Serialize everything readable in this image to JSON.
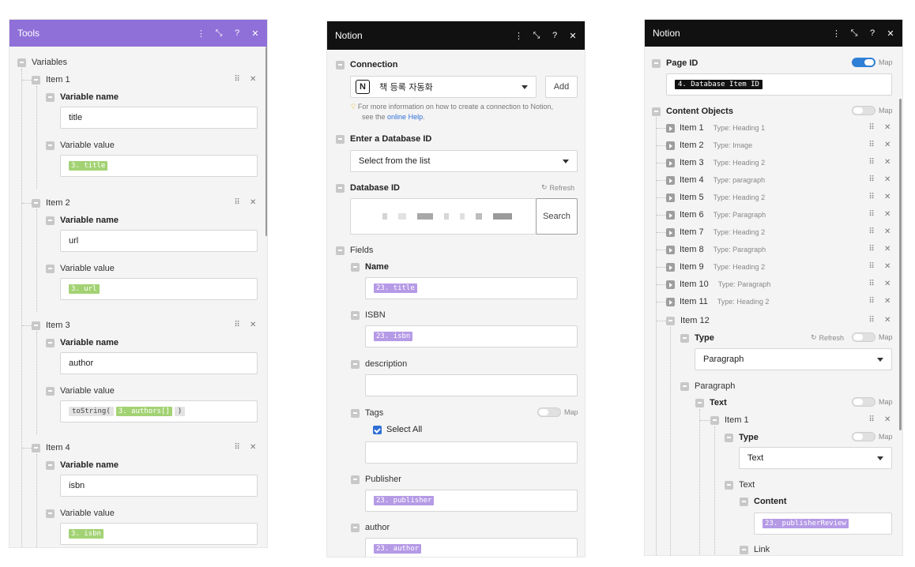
{
  "tools": {
    "title": "Tools",
    "variables_label": "Variables",
    "items": [
      {
        "label": "Item 1",
        "var_name_label": "Variable name",
        "var_name": "title",
        "var_value_label": "Variable value",
        "value_pill": "3. title"
      },
      {
        "label": "Item 2",
        "var_name_label": "Variable name",
        "var_name": "url",
        "var_value_label": "Variable value",
        "value_pill": "3. url"
      },
      {
        "label": "Item 3",
        "var_name_label": "Variable name",
        "var_name": "author",
        "var_value_label": "Variable value",
        "value_func": "toString(",
        "value_pill": "3. authors[]",
        "value_close": ")"
      },
      {
        "label": "Item 4",
        "var_name_label": "Variable name",
        "var_name": "isbn",
        "var_value_label": "Variable value",
        "value_pill": "3. isbn"
      }
    ]
  },
  "notion1": {
    "title": "Notion",
    "connection_label": "Connection",
    "connection_value": "책 등록 자동화",
    "add_label": "Add",
    "info_text_1": "For more information on how to create a connection to Notion,",
    "info_text_2": "see the",
    "info_link": "online Help",
    "info_end": ".",
    "enter_db_label": "Enter a Database ID",
    "enter_db_value": "Select from the list",
    "dbid_label": "Database ID",
    "refresh_label": "Refresh",
    "search_label": "Search",
    "fields_label": "Fields",
    "name_label": "Name",
    "name_pill": "23. title",
    "isbn_label": "ISBN",
    "isbn_pill": "23. isbn",
    "description_label": "description",
    "tags_label": "Tags",
    "map_label": "Map",
    "select_all_label": "Select All",
    "publisher_label": "Publisher",
    "publisher_pill": "23. publisher",
    "author_label": "author",
    "author_pill": "23. author"
  },
  "notion2": {
    "title": "Notion",
    "page_id_label": "Page ID",
    "map_label": "Map",
    "page_id_pill": "4. Database Item ID",
    "content_objects_label": "Content Objects",
    "items": [
      {
        "label": "Item 1",
        "type": "Type: Heading 1"
      },
      {
        "label": "Item 2",
        "type": "Type: Image"
      },
      {
        "label": "Item 3",
        "type": "Type: Heading 2"
      },
      {
        "label": "Item 4",
        "type": "Type: paragraph"
      },
      {
        "label": "Item 5",
        "type": "Type: Heading 2"
      },
      {
        "label": "Item 6",
        "type": "Type: Paragraph"
      },
      {
        "label": "Item 7",
        "type": "Type: Heading 2"
      },
      {
        "label": "Item 8",
        "type": "Type: Paragraph"
      },
      {
        "label": "Item 9",
        "type": "Type: Heading 2"
      },
      {
        "label": "Item 10",
        "type": "Type: Paragraph"
      },
      {
        "label": "Item 11",
        "type": "Type: Heading 2"
      }
    ],
    "item12_label": "Item 12",
    "type_label": "Type",
    "refresh_label": "Refresh",
    "type_value": "Paragraph",
    "paragraph_label": "Paragraph",
    "text_label": "Text",
    "sub_item_label": "Item 1",
    "sub_type_label": "Type",
    "sub_type_value": "Text",
    "text_sub_label": "Text",
    "content_label": "Content",
    "content_pill": "23. publisherReview",
    "link_label": "Link"
  },
  "colors": {
    "tools_header": "#8f6fd8",
    "notion_header": "#111111",
    "link": "#2f6fd6"
  }
}
